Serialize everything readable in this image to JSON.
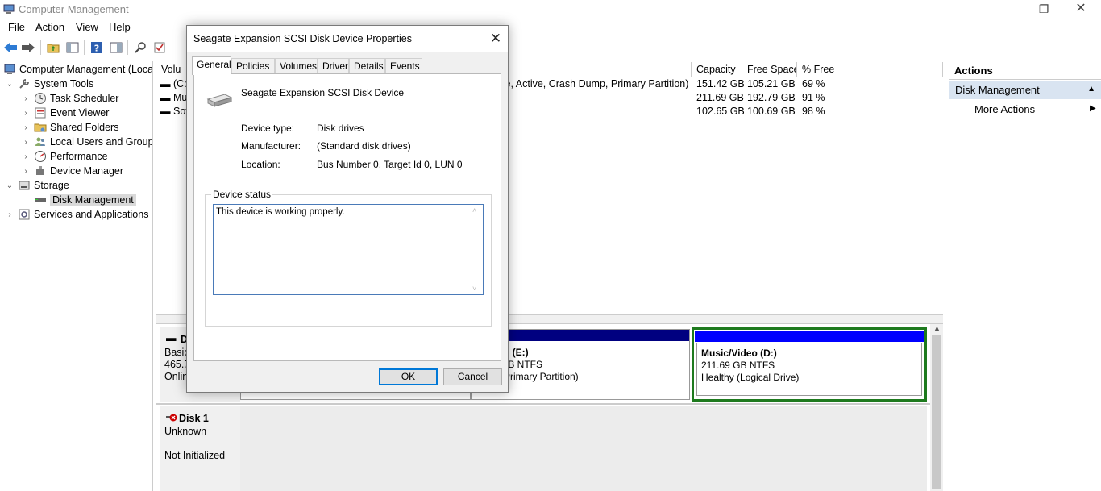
{
  "window": {
    "title": "Computer Management",
    "min_glyph": "—",
    "max_glyph": "❐",
    "close_glyph": "✕"
  },
  "menu": [
    "File",
    "Action",
    "View",
    "Help"
  ],
  "tree": {
    "root": "Computer Management (Local",
    "items": [
      {
        "label": "System Tools",
        "icon": "tools-icon",
        "level": 1,
        "expanded": true
      },
      {
        "label": "Task Scheduler",
        "icon": "clock-icon",
        "level": 2
      },
      {
        "label": "Event Viewer",
        "icon": "event-viewer-icon",
        "level": 2
      },
      {
        "label": "Shared Folders",
        "icon": "shared-folder-icon",
        "level": 2
      },
      {
        "label": "Local Users and Groups",
        "icon": "users-icon",
        "level": 2
      },
      {
        "label": "Performance",
        "icon": "performance-icon",
        "level": 2
      },
      {
        "label": "Device Manager",
        "icon": "device-manager-icon",
        "level": 2
      },
      {
        "label": "Storage",
        "icon": "storage-icon",
        "level": 1,
        "expanded": true
      },
      {
        "label": "Disk Management",
        "icon": "disk-icon",
        "level": 2,
        "selected": true
      },
      {
        "label": "Services and Applications",
        "icon": "services-icon",
        "level": 1
      }
    ]
  },
  "volumes": {
    "headers": {
      "volume": "Volu",
      "capacity": "Capacity",
      "free": "Free Space",
      "pct": "% Free"
    },
    "rows": [
      {
        "name": "(C:",
        "status": "ile, Active, Crash Dump, Primary Partition)",
        "capacity": "151.42 GB",
        "free": "105.21 GB",
        "pct": "69 %"
      },
      {
        "name": "Mu",
        "status": "",
        "capacity": "211.69 GB",
        "free": "192.79 GB",
        "pct": "91 %"
      },
      {
        "name": "Sof",
        "status": "",
        "capacity": "102.65 GB",
        "free": "100.69 GB",
        "pct": "98 %"
      }
    ]
  },
  "disks": {
    "disk0": {
      "name": "D",
      "type": "Basic",
      "size": "465.7",
      "state": "Onlin",
      "part_e": {
        "title": "re  (E:)",
        "size": "GB NTFS",
        "status": "(Primary Partition)"
      },
      "part_d": {
        "title": "Music/Video  (D:)",
        "size": "211.69 GB NTFS",
        "status": "Healthy (Logical Drive)"
      }
    },
    "disk1": {
      "name": "Disk 1",
      "type": "Unknown",
      "state": "Not Initialized"
    }
  },
  "actions": {
    "header": "Actions",
    "section": "Disk Management",
    "more": "More Actions"
  },
  "dialog": {
    "title": "Seagate Expansion SCSI Disk Device Properties",
    "tabs": [
      "General",
      "Policies",
      "Volumes",
      "Driver",
      "Details",
      "Events"
    ],
    "device_name": "Seagate Expansion SCSI Disk Device",
    "props": [
      {
        "label": "Device type:",
        "value": "Disk drives"
      },
      {
        "label": "Manufacturer:",
        "value": "(Standard disk drives)"
      },
      {
        "label": "Location:",
        "value": "Bus Number 0, Target Id 0, LUN 0"
      }
    ],
    "status_group": "Device status",
    "status_text": "This device is working properly.",
    "ok": "OK",
    "cancel": "Cancel"
  },
  "colors": {
    "primary_bar": "#000080",
    "logical_bar": "#0000ff",
    "selected_border": "#1e7a1e",
    "accent": "#0078d7"
  }
}
